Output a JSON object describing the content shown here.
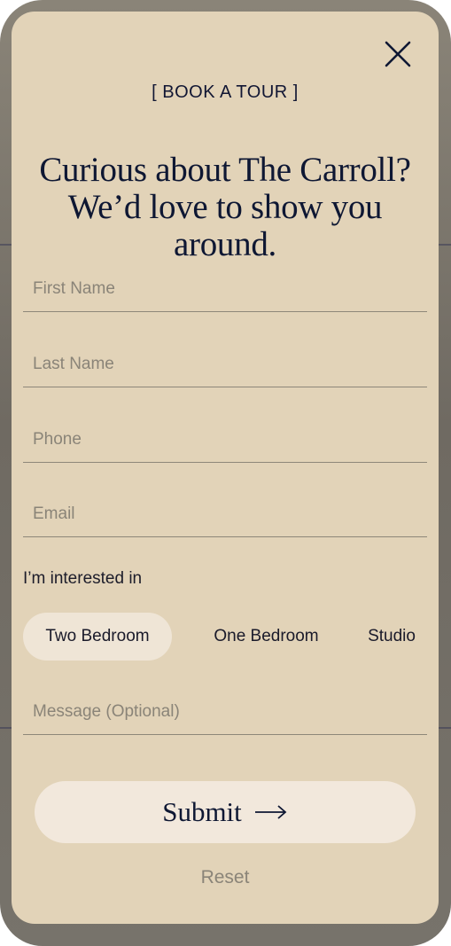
{
  "modal": {
    "eyebrow": "[ BOOK A TOUR ]",
    "headline_line1": "Curious about The Carroll?",
    "headline_line2": "We’d love to show you around."
  },
  "form": {
    "first_name_placeholder": "First Name",
    "last_name_placeholder": "Last Name",
    "phone_placeholder": "Phone",
    "email_placeholder": "Email",
    "interest_label": "I’m interested in",
    "interest_options": [
      "Two Bedroom",
      "One Bedroom",
      "Studio"
    ],
    "selected_interest": "Two Bedroom",
    "message_placeholder": "Message (Optional)",
    "submit_label": "Submit",
    "reset_label": "Reset"
  },
  "icons": {
    "close": "close-icon",
    "submit_arrow": "arrow-right-icon"
  },
  "colors": {
    "modal_background": "#e2d3b8",
    "text_dark": "#0e1733",
    "placeholder": "#8a8478",
    "chip_selected": "#efe5d6",
    "submit_background": "#f2e8dc"
  }
}
